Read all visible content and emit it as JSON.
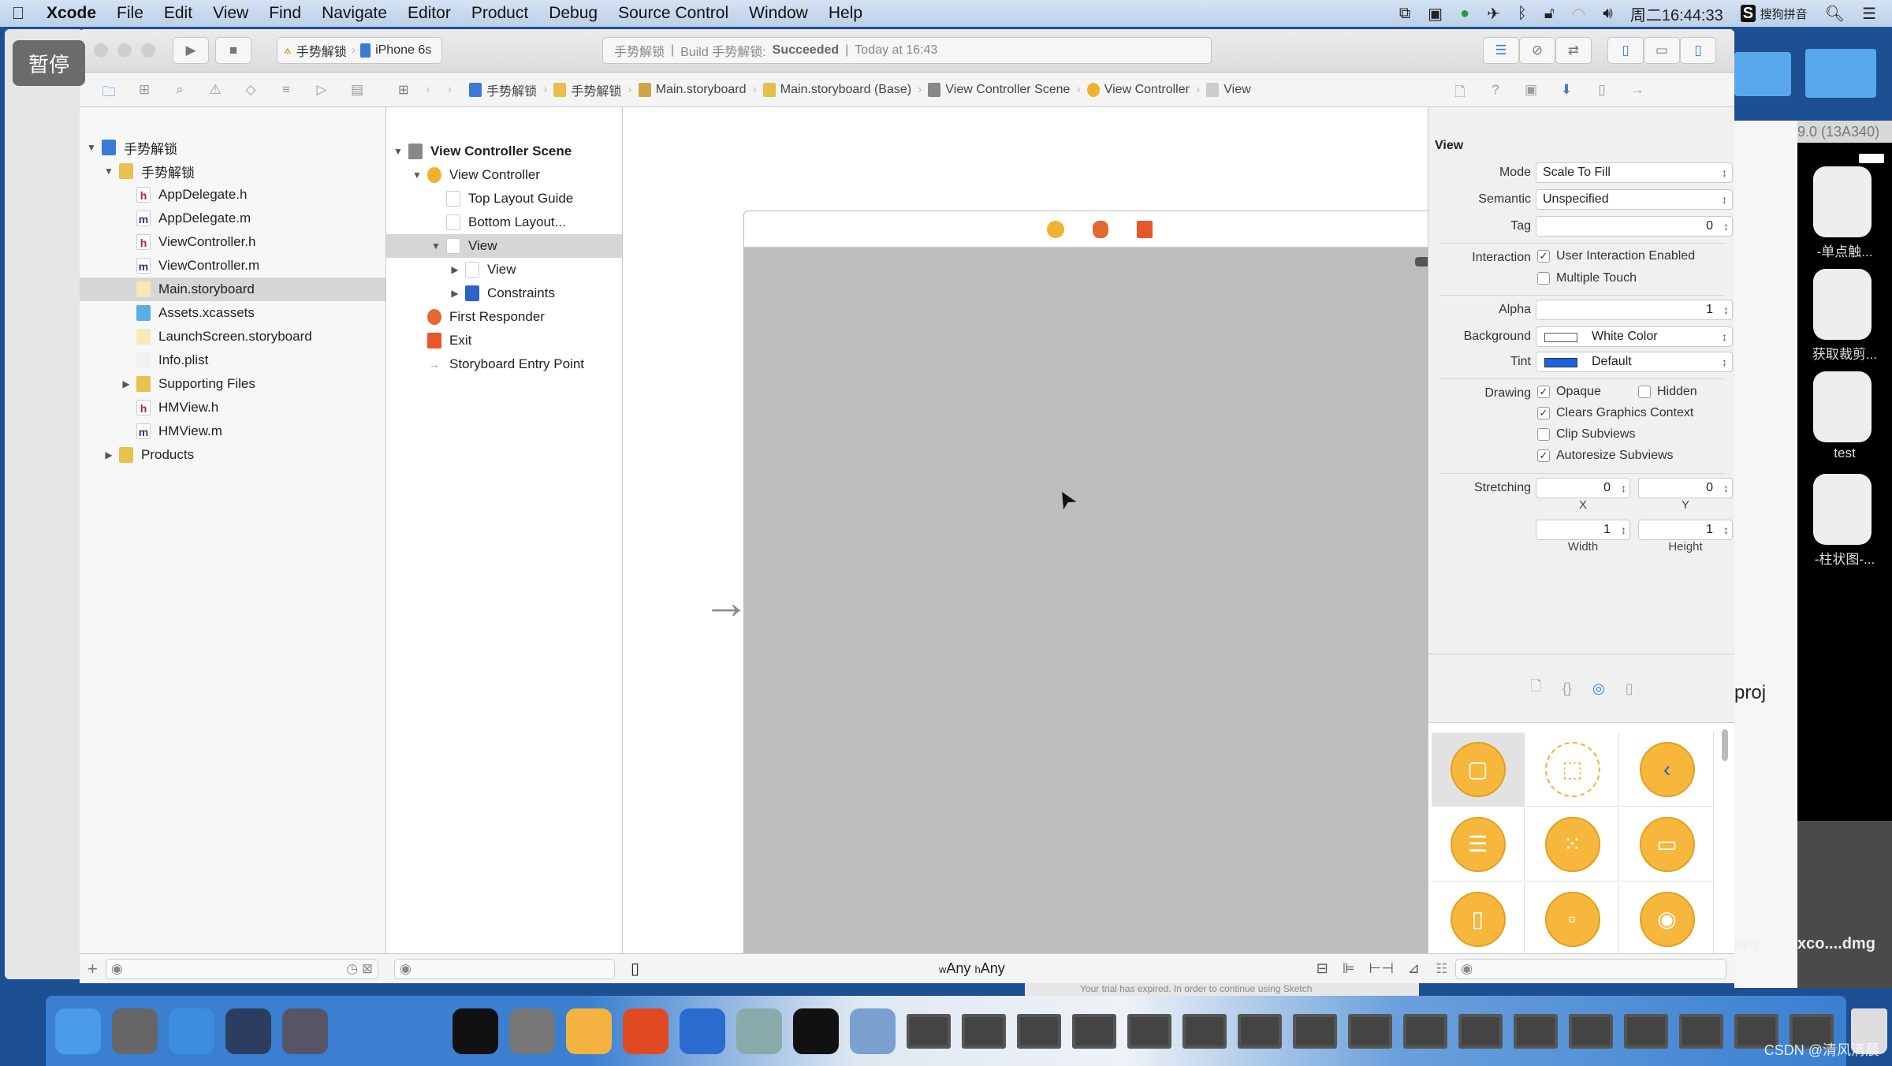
{
  "menubar": {
    "app": "Xcode",
    "items": [
      "File",
      "Edit",
      "View",
      "Find",
      "Navigate",
      "Editor",
      "Product",
      "Debug",
      "Source Control",
      "Window",
      "Help"
    ],
    "clock": "周二16:44:33",
    "input_method": "搜狗拼音"
  },
  "overlay": {
    "pause_label": "暂停"
  },
  "toolbar": {
    "scheme": "手势解锁",
    "device": "iPhone 6s",
    "activity_project": "手势解锁",
    "activity_build": "Build 手势解锁:",
    "activity_status": "Succeeded",
    "activity_time": "Today at 16:43"
  },
  "jumpbar": [
    "手势解锁",
    "手势解锁",
    "Main.storyboard",
    "Main.storyboard (Base)",
    "View Controller Scene",
    "View Controller",
    "View"
  ],
  "navigator": {
    "items": [
      {
        "label": "手势解锁",
        "kind": "project",
        "depth": 0,
        "disclosure": "open"
      },
      {
        "label": "手势解锁",
        "kind": "folder",
        "depth": 1,
        "disclosure": "open"
      },
      {
        "label": "AppDelegate.h",
        "kind": "h",
        "depth": 2
      },
      {
        "label": "AppDelegate.m",
        "kind": "m",
        "depth": 2
      },
      {
        "label": "ViewController.h",
        "kind": "h",
        "depth": 2
      },
      {
        "label": "ViewController.m",
        "kind": "m",
        "depth": 2
      },
      {
        "label": "Main.storyboard",
        "kind": "storyboard",
        "depth": 2,
        "selected": true
      },
      {
        "label": "Assets.xcassets",
        "kind": "assets",
        "depth": 2
      },
      {
        "label": "LaunchScreen.storyboard",
        "kind": "storyboard",
        "depth": 2
      },
      {
        "label": "Info.plist",
        "kind": "plist",
        "depth": 2
      },
      {
        "label": "Supporting Files",
        "kind": "folder",
        "depth": 2,
        "disclosure": "closed"
      },
      {
        "label": "HMView.h",
        "kind": "h",
        "depth": 2
      },
      {
        "label": "HMView.m",
        "kind": "m",
        "depth": 2
      },
      {
        "label": "Products",
        "kind": "folder",
        "depth": 1,
        "disclosure": "closed"
      }
    ]
  },
  "outline": {
    "items": [
      {
        "label": "View Controller Scene",
        "kind": "scene",
        "depth": 0,
        "disclosure": "open",
        "bold": true
      },
      {
        "label": "View Controller",
        "kind": "vc",
        "depth": 1,
        "disclosure": "open"
      },
      {
        "label": "Top Layout Guide",
        "kind": "guide",
        "depth": 2
      },
      {
        "label": "Bottom Layout...",
        "kind": "guide",
        "depth": 2
      },
      {
        "label": "View",
        "kind": "view",
        "depth": 2,
        "disclosure": "open",
        "selected": true
      },
      {
        "label": "View",
        "kind": "view",
        "depth": 3,
        "disclosure": "closed"
      },
      {
        "label": "Constraints",
        "kind": "constraints",
        "depth": 3,
        "disclosure": "closed"
      },
      {
        "label": "First Responder",
        "kind": "responder",
        "depth": 1
      },
      {
        "label": "Exit",
        "kind": "exit",
        "depth": 1
      },
      {
        "label": "Storyboard Entry Point",
        "kind": "entry",
        "depth": 1
      }
    ]
  },
  "canvas": {
    "size_class_w": "Any",
    "size_class_h": "Any",
    "w_prefix": "w",
    "h_prefix": "h"
  },
  "inspector": {
    "section": "View",
    "mode_label": "Mode",
    "mode": "Scale To Fill",
    "semantic_label": "Semantic",
    "semantic": "Unspecified",
    "tag_label": "Tag",
    "tag": "0",
    "interaction_label": "Interaction",
    "user_interaction": {
      "label": "User Interaction Enabled",
      "checked": true
    },
    "multiple_touch": {
      "label": "Multiple Touch",
      "checked": false
    },
    "alpha_label": "Alpha",
    "alpha": "1",
    "background_label": "Background",
    "background": "White Color",
    "background_color": "#ffffff",
    "tint_label": "Tint",
    "tint": "Default",
    "tint_color": "#1b63e0",
    "drawing_label": "Drawing",
    "opaque": {
      "label": "Opaque",
      "checked": true
    },
    "hidden": {
      "label": "Hidden",
      "checked": false
    },
    "clears": {
      "label": "Clears Graphics Context",
      "checked": true
    },
    "clip": {
      "label": "Clip Subviews",
      "checked": false
    },
    "autoresize": {
      "label": "Autoresize Subviews",
      "checked": true
    },
    "stretching_label": "Stretching",
    "stretch_x": "0",
    "stretch_y": "0",
    "stretch_w": "1",
    "stretch_h": "1",
    "x_label": "X",
    "y_label": "Y",
    "w_label": "Width",
    "h_label": "Height"
  },
  "library": {
    "items": [
      "view-controller",
      "storyboard-reference",
      "navigation-controller",
      "table-view-controller",
      "collection-view-controller",
      "tab-bar-controller",
      "split-view-controller",
      "page-view-controller",
      "glkit-view-controller"
    ],
    "accent": "#f6b73c"
  },
  "desktop": {
    "simulator_title": "9.0 (13A340)",
    "app_labels": [
      "-单点触...",
      "获取裁剪...",
      "test",
      "-柱状图-..."
    ],
    "proj_text": "proj",
    "file1": "opy",
    "file2": "xco....dmg",
    "trial_text": "Your trial has expired. In order to continue using Sketch"
  },
  "watermark": "CSDN @清风清晨"
}
